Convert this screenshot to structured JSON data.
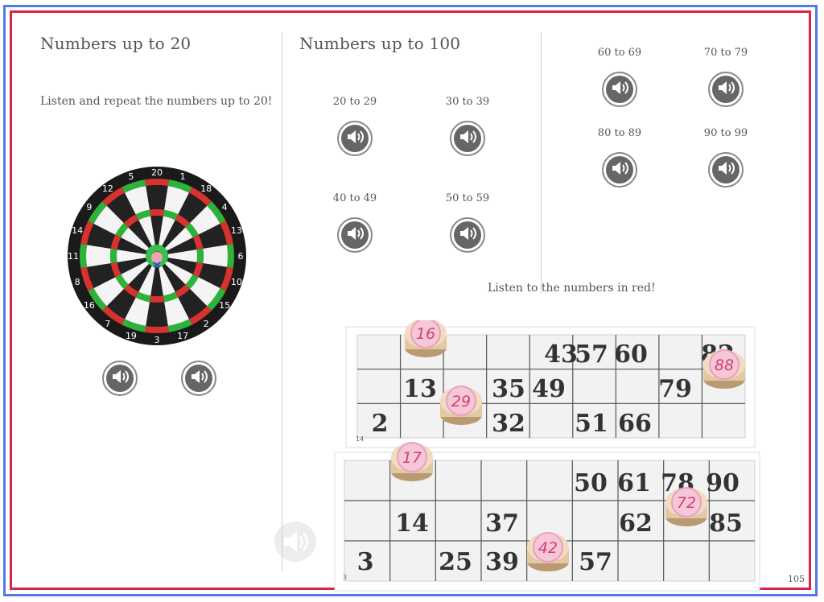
{
  "left_panel": {
    "heading": "Numbers up to 20",
    "instruction": "Listen and repeat the numbers up to 20!",
    "dartboard_numbers": [
      "20",
      "1",
      "18",
      "4",
      "13",
      "6",
      "10",
      "15",
      "2",
      "17",
      "3",
      "19",
      "7",
      "16",
      "8",
      "11",
      "14",
      "9",
      "12",
      "5"
    ]
  },
  "middle_panel": {
    "heading": "Numbers up to 100",
    "ranges": [
      "20 to 29",
      "30 to 39",
      "40 to 49",
      "50 to 59"
    ]
  },
  "right_panel": {
    "ranges": [
      "60 to 69",
      "70 to 79",
      "80 to 89",
      "90 to 99"
    ],
    "instruction": "Listen to the numbers in red!"
  },
  "bingo": {
    "card1": {
      "row1": [
        "43",
        "57",
        "60",
        "82"
      ],
      "row2": [
        "13",
        "35",
        "49",
        "79"
      ],
      "row3": [
        "2",
        "32",
        "51",
        "66"
      ],
      "tokens": [
        "16",
        "29",
        "88"
      ],
      "corner_label": "14"
    },
    "card2": {
      "row1": [
        "50",
        "61",
        "78",
        "90"
      ],
      "row2": [
        "14",
        "37",
        "62",
        "85"
      ],
      "row3": [
        "3",
        "25",
        "39",
        "57"
      ],
      "tokens": [
        "17",
        "72",
        "42"
      ],
      "corner_label": "3"
    }
  },
  "page_number": "105",
  "icons": {
    "audio": "speaker-icon"
  },
  "colors": {
    "outer_frame": "#5578e8",
    "inner_frame": "#d6244a",
    "token_text": "#d0407a"
  }
}
